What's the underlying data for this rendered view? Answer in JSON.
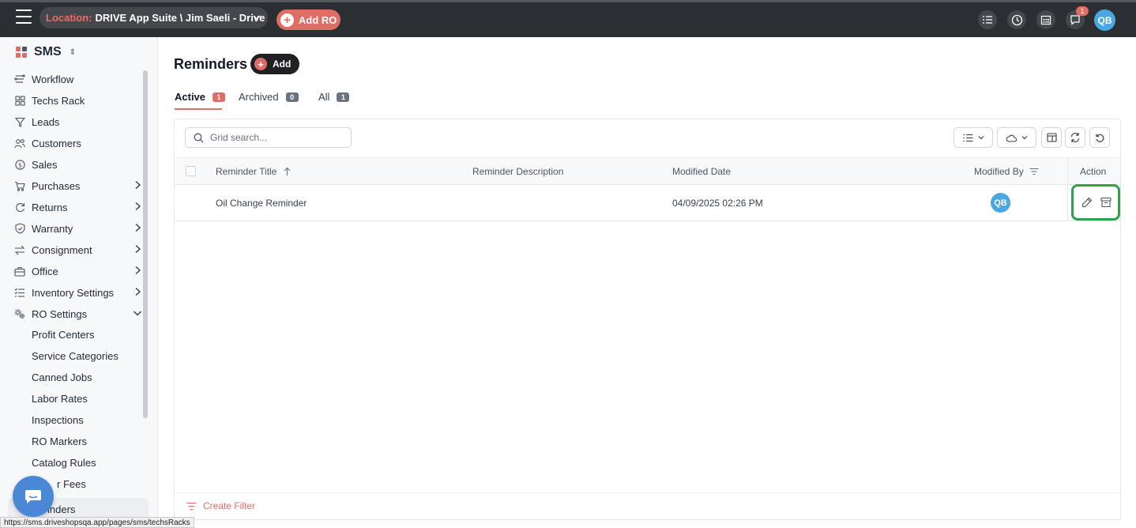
{
  "topbar": {
    "location_label": "Location:",
    "location_value": "DRIVE App Suite \\ Jim Saeli - Drive",
    "add_ro_label": "Add RO",
    "notification_count": "1",
    "user_initials": "QB"
  },
  "sidebar": {
    "app_name": "SMS",
    "items": [
      {
        "label": "Workflow",
        "icon": "workflow-icon"
      },
      {
        "label": "Techs Rack",
        "icon": "grid-icon"
      },
      {
        "label": "Leads",
        "icon": "filter-icon"
      },
      {
        "label": "Customers",
        "icon": "users-icon"
      },
      {
        "label": "Sales",
        "icon": "dollar-icon"
      },
      {
        "label": "Purchases",
        "icon": "cart-icon"
      },
      {
        "label": "Returns",
        "icon": "refresh-icon"
      },
      {
        "label": "Warranty",
        "icon": "shield-icon"
      },
      {
        "label": "Consignment",
        "icon": "swap-icon"
      },
      {
        "label": "Office",
        "icon": "briefcase-icon"
      },
      {
        "label": "Inventory Settings",
        "icon": "list-check-icon"
      },
      {
        "label": "RO Settings",
        "icon": "gears-icon"
      }
    ],
    "ro_settings_sub": [
      "Profit Centers",
      "Service Categories",
      "Canned Jobs",
      "Labor Rates",
      "Inspections",
      "RO Markers",
      "Catalog Rules",
      "r Fees",
      "inders"
    ]
  },
  "page": {
    "title": "Reminders",
    "add_label": "Add",
    "tabs": [
      {
        "label": "Active",
        "count": "1"
      },
      {
        "label": "Archived",
        "count": "0"
      },
      {
        "label": "All",
        "count": "1"
      }
    ],
    "search_placeholder": "Grid search...",
    "columns": {
      "title": "Reminder Title",
      "description": "Reminder Description",
      "modified_date": "Modified Date",
      "modified_by": "Modified By",
      "action": "Action"
    },
    "rows": [
      {
        "title": "Oil Change Reminder",
        "description": "",
        "modified_date": "04/09/2025 02:26 PM",
        "modified_by": "QB"
      }
    ],
    "create_filter_label": "Create Filter"
  },
  "status_url": "https://sms.driveshopsqa.app/pages/sms/techsRacks",
  "colors": {
    "accent": "#e06c66",
    "topbar": "#2b2e33",
    "avatar": "#4aa8e0",
    "highlight": "#2ea14a"
  }
}
